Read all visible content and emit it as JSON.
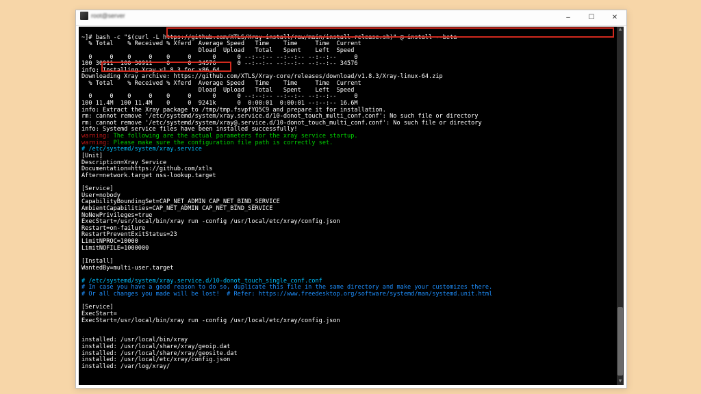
{
  "window": {
    "title": "root@server",
    "buttons": {
      "min": "–",
      "max": "☐",
      "close": "✕"
    }
  },
  "cmd": "bash -c \"$(curl -L https://github.com/XTLS/Xray-install/raw/main/install-release.sh)\" @ install --beta",
  "prompt1": "~]# ",
  "curl1": {
    "h1": "  % Total    % Received % Xferd  Average Speed   Time    Time     Time  Current",
    "h2": "                                 Dload  Upload   Total   Spent    Left  Speed",
    "r1": "  0     0    0     0    0     0      0      0 --:--:-- --:--:-- --:--:--     0",
    "r2": "100 30911  100 30911    0     0  34576      0 --:--:-- --:--:-- --:--:-- 34576"
  },
  "info_install_pre": "info: ",
  "info_install": "Installing Xray v1.8.3 for x86_64",
  "dl": "Downloading Xray archive: https://github.com/XTLS/Xray-core/releases/download/v1.8.3/Xray-linux-64.zip",
  "curl2": {
    "h1": "  % Total    % Received % Xferd  Average Speed   Time    Time     Time  Current",
    "h2": "                                 Dload  Upload   Total   Spent    Left  Speed",
    "r1": "  0     0    0     0    0     0      0      0 --:--:-- --:--:-- --:--:--     0",
    "r2": "100 11.4M  100 11.4M    0     0  9241k      0  0:00:01  0:00:01 --:--:-- 16.6M"
  },
  "post": {
    "extract": "info: Extract the Xray package to /tmp/tmp.fsvpfYQ5C9 and prepare it for installation.",
    "rm1": "rm: cannot remove '/etc/systemd/system/xray.service.d/10-donot_touch_multi_conf.conf': No such file or directory",
    "rm2": "rm: cannot remove '/etc/systemd/system/xray@.service.d/10-donot_touch_multi_conf.conf': No such file or directory",
    "svc": "info: Systemd service files have been installed successfully!"
  },
  "warns": {
    "label": "warning:",
    "w1": " The following are the actual parameters for the xray service startup.",
    "w2": " Please make sure the configuration file path is correctly set."
  },
  "svcpath": "# /etc/systemd/system/xray.service",
  "unit": [
    "[Unit]",
    "Description=Xray Service",
    "Documentation=https://github.com/xtls",
    "After=network.target nss-lookup.target",
    "",
    "[Service]",
    "User=nobody",
    "CapabilityBoundingSet=CAP_NET_ADMIN CAP_NET_BIND_SERVICE",
    "AmbientCapabilities=CAP_NET_ADMIN CAP_NET_BIND_SERVICE",
    "NoNewPrivileges=true",
    "ExecStart=/usr/local/bin/xray run -config /usr/local/etc/xray/config.json",
    "Restart=on-failure",
    "RestartPreventExitStatus=23",
    "LimitNPROC=10000",
    "LimitNOFILE=1000000",
    "",
    "[Install]",
    "WantedBy=multi-user.target"
  ],
  "svcpath2": "# /etc/systemd/system/xray.service.d/10-donot_touch_single_conf.conf",
  "hints": [
    "# In case you have a good reason to do so, duplicate this file in the same directory and make your customizes there.",
    "# Or all changes you made will be lost!  # Refer: https://www.freedesktop.org/software/systemd/man/systemd.unit.html"
  ],
  "svc2": [
    "[Service]",
    "ExecStart=",
    "ExecStart=/usr/local/bin/xray run -config /usr/local/etc/xray/config.json"
  ],
  "installed": [
    "installed: /usr/local/bin/xray",
    "installed: /usr/local/share/xray/geoip.dat",
    "installed: /usr/local/share/xray/geosite.dat",
    "installed: /usr/local/etc/xray/config.json",
    "installed: /var/log/xray/"
  ]
}
